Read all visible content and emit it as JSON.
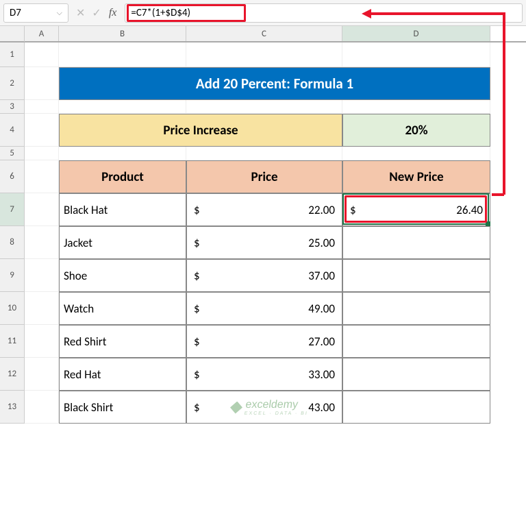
{
  "nameBox": "D7",
  "formula": "=C7*(1+$D$4)",
  "columns": [
    "A",
    "B",
    "C",
    "D"
  ],
  "rows": [
    "1",
    "2",
    "3",
    "4",
    "5",
    "6",
    "7",
    "8",
    "9",
    "10",
    "11",
    "12",
    "13"
  ],
  "activeRow": "7",
  "activeCol": "D",
  "title": "Add 20 Percent: Formula 1",
  "priceIncreaseLabel": "Price Increase",
  "priceIncreaseValue": "20%",
  "headers": {
    "product": "Product",
    "price": "Price",
    "newPrice": "New Price"
  },
  "currency": "$",
  "items": [
    {
      "product": "Black Hat",
      "price": "22.00",
      "newPrice": "26.40"
    },
    {
      "product": "Jacket",
      "price": "25.00",
      "newPrice": ""
    },
    {
      "product": "Shoe",
      "price": "37.00",
      "newPrice": ""
    },
    {
      "product": "Watch",
      "price": "49.00",
      "newPrice": ""
    },
    {
      "product": "Red Shirt",
      "price": "27.00",
      "newPrice": ""
    },
    {
      "product": "Red Hat",
      "price": "33.00",
      "newPrice": ""
    },
    {
      "product": "Black Shirt",
      "price": "43.00",
      "newPrice": ""
    }
  ],
  "watermark": {
    "text": "exceldemy",
    "sub": "EXCEL · DATA · BI"
  }
}
